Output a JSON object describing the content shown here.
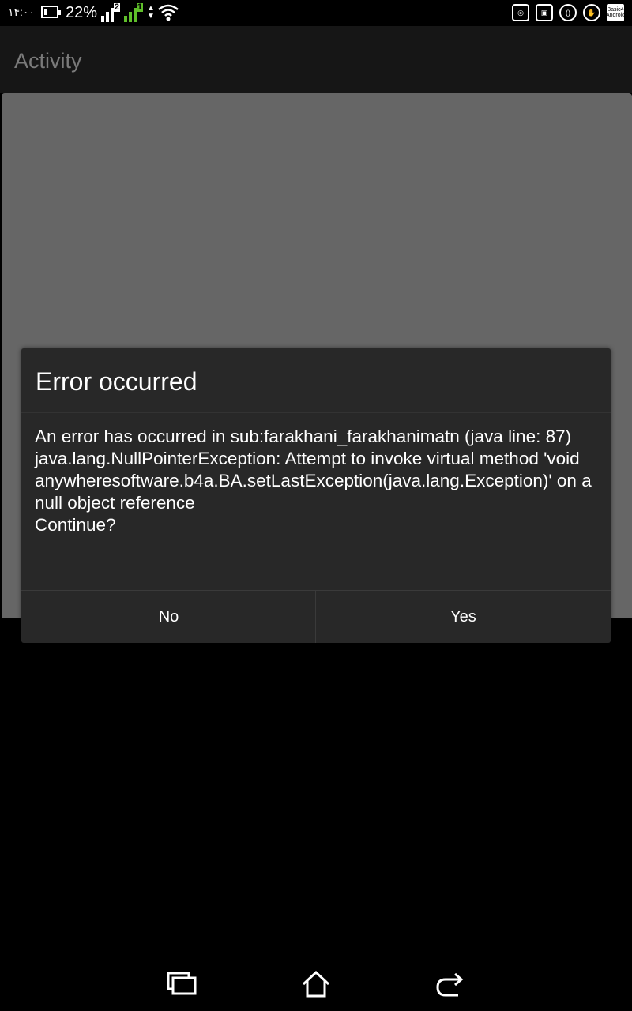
{
  "status_bar": {
    "time": "۱۴:۰۰",
    "battery_percent": "22%",
    "battery_level": 0.22,
    "sim1_badge": "2",
    "sim2_badge": "1",
    "notification_icons": [
      "instagram-icon",
      "photo-icon",
      "parentheses-icon",
      "cat-icon",
      "basic4android-icon"
    ],
    "basic_label": "Basic4 Android"
  },
  "action_bar": {
    "title": "Activity"
  },
  "dialog": {
    "title": "Error occurred",
    "message": "An error has occurred in sub:farakhani_farakhanimatn (java line: 87)\njava.lang.NullPointerException: Attempt to invoke virtual method 'void anywheresoftware.b4a.BA.setLastException(java.lang.Exception)' on a null object reference\nContinue?",
    "negative_label": "No",
    "positive_label": "Yes"
  },
  "colors": {
    "background": "#000000",
    "action_bar": "#161616",
    "content_panel": "#666666",
    "dialog": "#282828",
    "sim2_accent": "#5fbf2a"
  },
  "nav_bar": {
    "icons": [
      "recent-apps-icon",
      "home-icon",
      "back-icon"
    ]
  }
}
